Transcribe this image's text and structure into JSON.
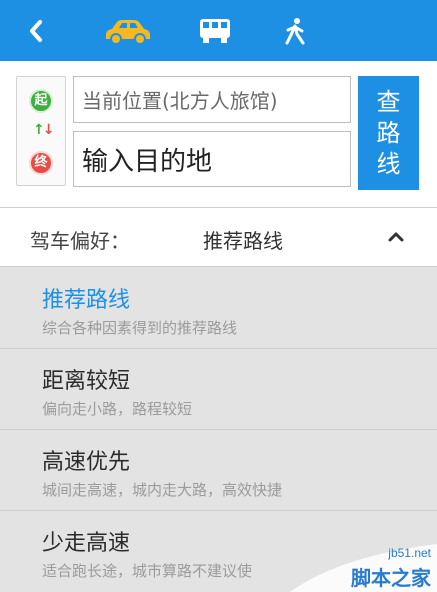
{
  "topbar": {
    "icons": [
      "back-icon",
      "car-icon",
      "bus-icon",
      "walk-icon"
    ],
    "colors": {
      "background": "#1e90e4",
      "car": "#f6b820",
      "icon": "#ffffff"
    }
  },
  "search": {
    "start_mark": "起",
    "end_mark": "终",
    "swap_up": "↑",
    "swap_down": "↓",
    "from_value": "当前位置(北方人旅馆)",
    "to_placeholder": "输入目的地",
    "query_label": "查路线"
  },
  "preference": {
    "label": "驾车偏好：",
    "value": "推荐路线"
  },
  "options": [
    {
      "title": "推荐路线",
      "desc": "综合各种因素得到的推荐路线",
      "selected": true
    },
    {
      "title": "距离较短",
      "desc": "偏向走小路，路程较短",
      "selected": false
    },
    {
      "title": "高速优先",
      "desc": "城间走高速，城内走大路，高效快捷",
      "selected": false
    },
    {
      "title": "少走高速",
      "desc": "适合跑长途，城市算路不建议使",
      "selected": false
    }
  ],
  "watermark": {
    "site": "jb51.net",
    "name": "脚本之家"
  },
  "colors": {
    "accent": "#1e90e4",
    "start": "#3fb03f",
    "end": "#e84a44",
    "list_bg": "#e3e3e3"
  }
}
